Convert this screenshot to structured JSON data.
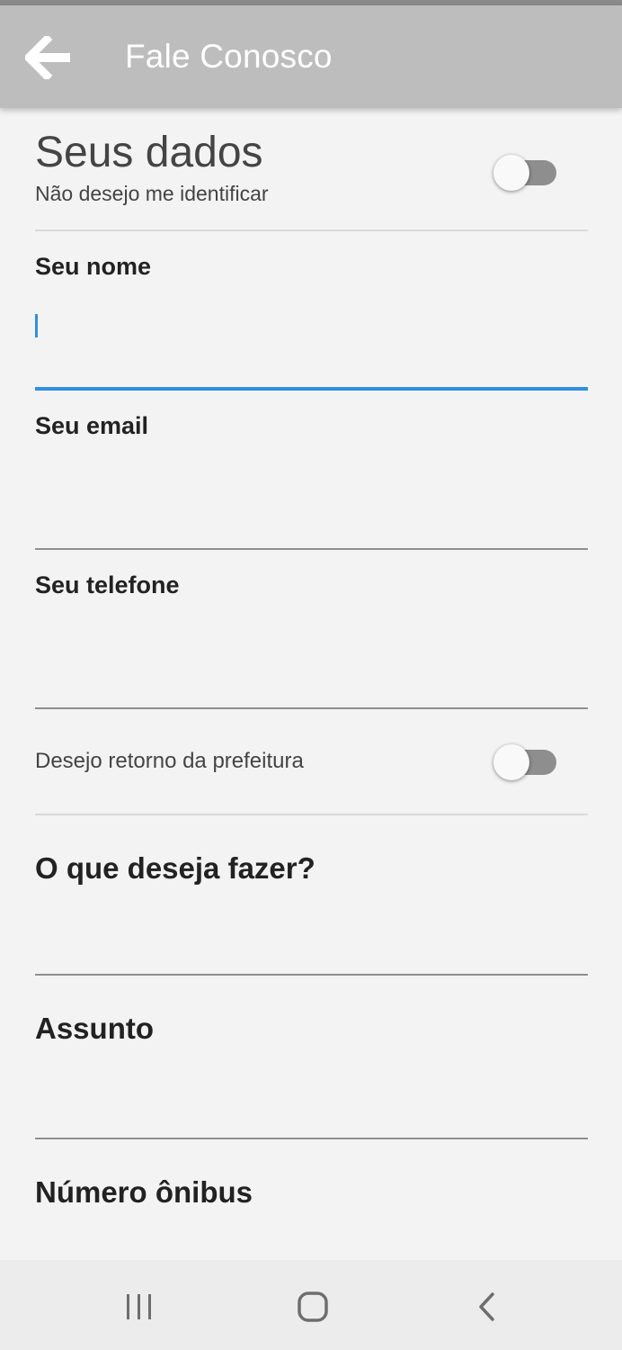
{
  "appbar": {
    "title": "Fale Conosco",
    "back_icon": "arrow-left-icon"
  },
  "identity": {
    "title": "Seus dados",
    "subtitle": "Não desejo me identificar",
    "anonymous_toggle_on": false
  },
  "fields": {
    "name": {
      "label": "Seu nome",
      "value": ""
    },
    "email": {
      "label": "Seu email",
      "value": ""
    },
    "phone": {
      "label": "Seu telefone",
      "value": ""
    }
  },
  "callback": {
    "label": "Desejo retorno da prefeitura",
    "toggle_on": false
  },
  "selects": {
    "action": {
      "label": "O que deseja fazer?"
    },
    "subject": {
      "label": "Assunto"
    },
    "bus_number": {
      "label": "Número ônibus"
    }
  },
  "navbar": {
    "icons": [
      "recent-apps-icon",
      "home-icon",
      "back-icon"
    ]
  },
  "colors": {
    "appbar": "#bdbdbd",
    "accent": "#2f8fe0",
    "background": "#f3f3f3"
  }
}
